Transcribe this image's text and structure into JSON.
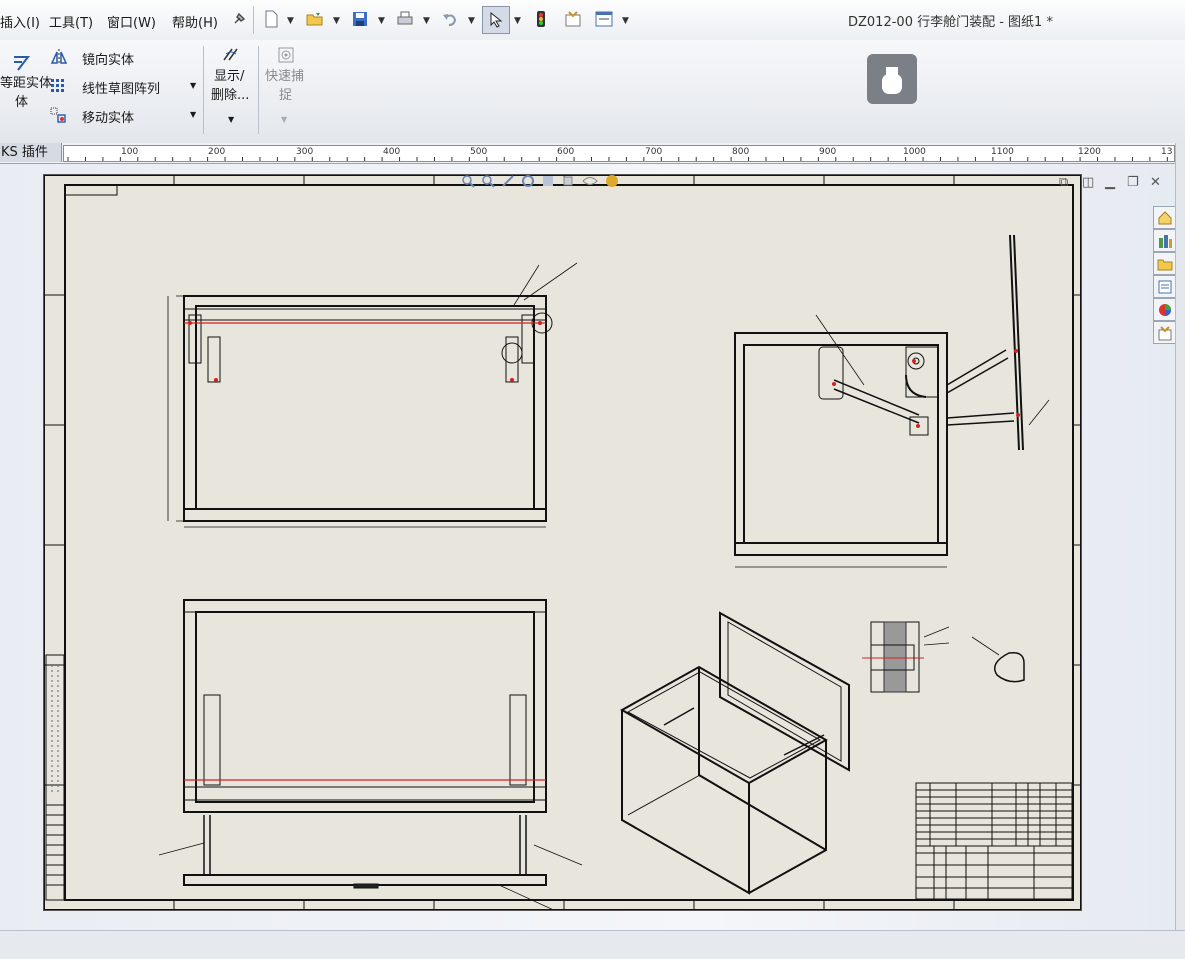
{
  "menu": {
    "items": [
      "插入(I)",
      "工具(T)",
      "窗口(W)",
      "帮助(H)"
    ]
  },
  "title": "DZ012-00 行李舱门装配 - 图纸1 *",
  "ribbon": {
    "offset_entity": "等距实体",
    "mirror_entity": "镜向实体",
    "linear_pattern": "线性草图阵列",
    "move_entity": "移动实体",
    "show_hide_line1": "显示/",
    "show_hide_line2": "删除...",
    "quick_snap_line1": "快速捕",
    "quick_snap_line2": "捉"
  },
  "ruler": {
    "tab": "KS 插件",
    "labels": [
      "100",
      "200",
      "300",
      "400",
      "500",
      "600",
      "700",
      "800",
      "900",
      "1000",
      "1100",
      "1200",
      "13"
    ]
  },
  "colors": {
    "sheet": "#e8e6dc",
    "accent_red": "#d62020"
  },
  "icons": [
    "pin-icon",
    "new-doc-icon",
    "open-folder-icon",
    "save-icon",
    "print-icon",
    "undo-icon",
    "select-arrow-icon",
    "traffic-light-icon",
    "options-icon",
    "window-icon",
    "usb-icon"
  ]
}
